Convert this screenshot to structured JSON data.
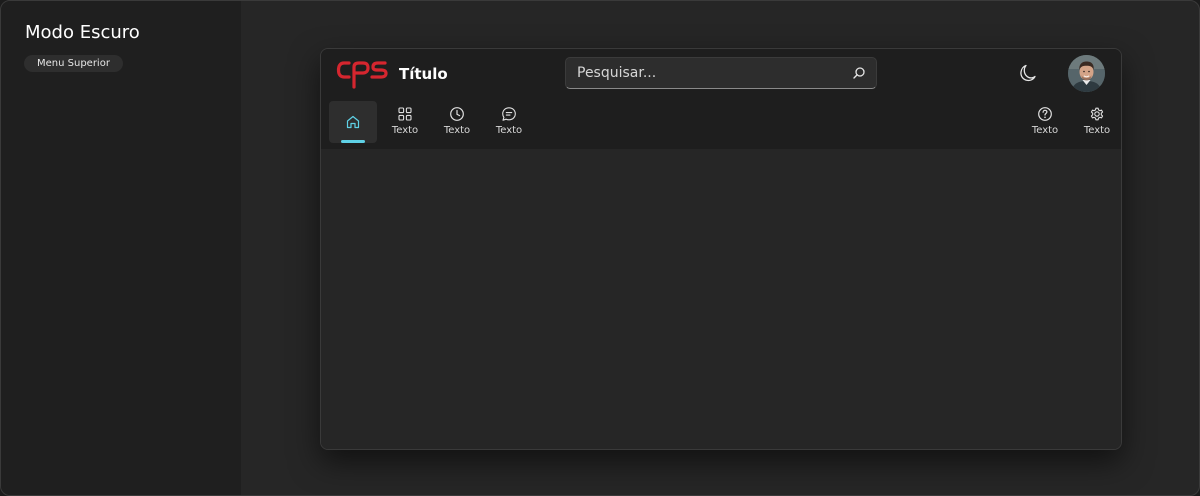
{
  "panel": {
    "title": "Modo Escuro",
    "badge": "Menu Superior"
  },
  "app": {
    "title": "Título",
    "brand_logo": "CPS",
    "brand_color": "#d5262f",
    "accent_color": "#5fd1e6",
    "search": {
      "placeholder": "Pesquisar...",
      "icon": "search-icon"
    },
    "theme_toggle_icon": "moon-icon",
    "nav": {
      "items": [
        {
          "icon": "home-icon",
          "label": "",
          "active": true
        },
        {
          "icon": "apps-grid-icon",
          "label": "Texto"
        },
        {
          "icon": "clock-icon",
          "label": "Texto"
        },
        {
          "icon": "chat-icon",
          "label": "Texto"
        }
      ],
      "right_items": [
        {
          "icon": "help-icon",
          "label": "Texto"
        },
        {
          "icon": "gear-icon",
          "label": "Texto"
        }
      ]
    }
  }
}
